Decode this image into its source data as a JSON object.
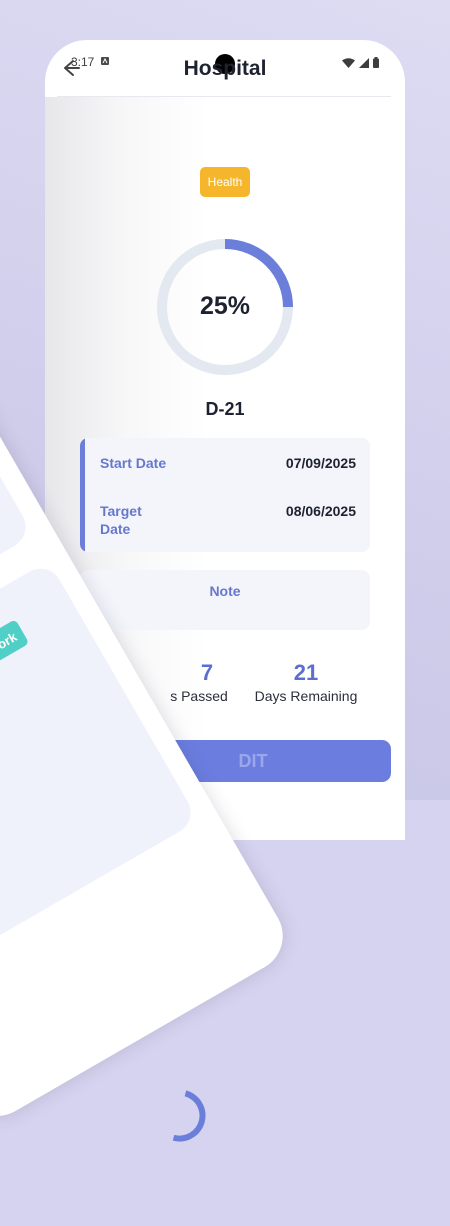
{
  "status_bar": {
    "time": "3:17"
  },
  "header": {
    "title": "Hospital"
  },
  "goal": {
    "category": "Health",
    "progress_percent": 25,
    "progress_text": "25%",
    "dday": "D-21"
  },
  "dates": {
    "start_label": "Start Date",
    "start_value": "07/09/2025",
    "target_label": "Target Date",
    "target_value": "08/06/2025"
  },
  "note": {
    "label": "Note"
  },
  "stats": {
    "passed_value": "7",
    "passed_label": "s Passed",
    "remaining_value": "21",
    "remaining_label": "Days Remaining"
  },
  "actions": {
    "edit_label": "DIT"
  },
  "overlay": {
    "badge_label": "Work"
  },
  "colors": {
    "accent": "#6b7ed9",
    "health_badge": "#f6b62c",
    "work_badge": "#4fcfc6",
    "ring_track": "#e4e8f0"
  }
}
